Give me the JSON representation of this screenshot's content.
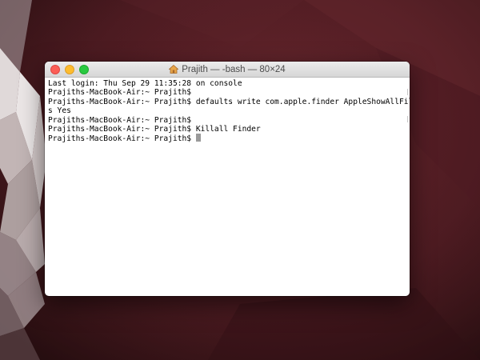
{
  "window": {
    "title": "Prajith — -bash — 80×24",
    "title_icon": "home-folder-icon"
  },
  "terminal": {
    "lines": [
      "Last login: Thu Sep 29 11:35:28 on console",
      "Prajiths-MacBook-Air:~ Prajith$",
      "Prajiths-MacBook-Air:~ Prajith$ defaults write com.apple.finder AppleShowAllFile",
      "s Yes",
      "Prajiths-MacBook-Air:~ Prajith$",
      "Prajiths-MacBook-Air:~ Prajith$ Killall Finder"
    ],
    "prompt": "Prajiths-MacBook-Air:~ Prajith$ "
  },
  "colors": {
    "close": "#fc5f57",
    "minimize": "#fdbc2e",
    "zoom": "#29c940",
    "desktop": "#5a2027",
    "cursor": "#9a9a9a"
  }
}
